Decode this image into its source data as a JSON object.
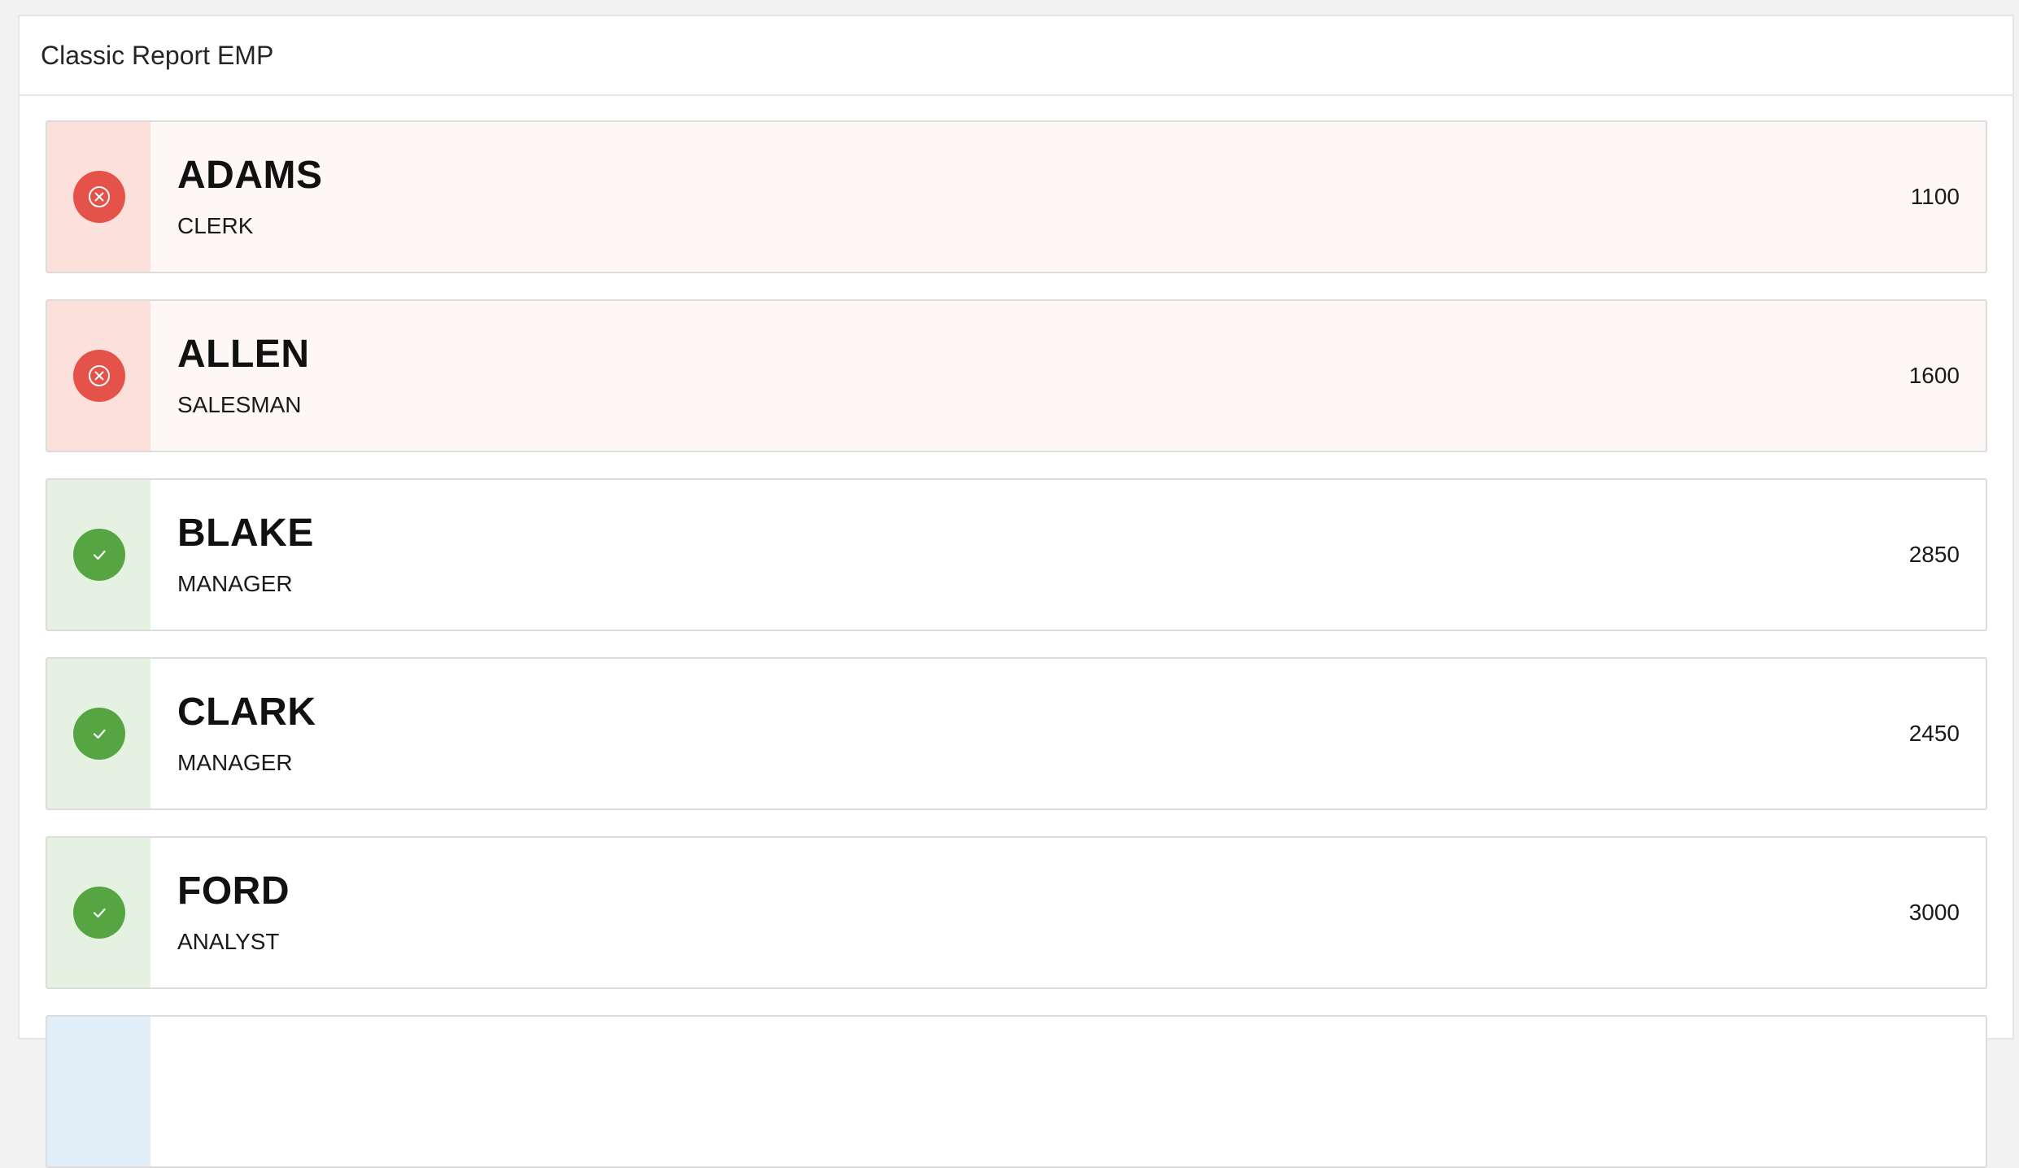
{
  "region": {
    "title": "Classic Report EMP"
  },
  "rows": [
    {
      "name": "ADAMS",
      "job": "CLERK",
      "value": "1100",
      "status": "danger",
      "icon": "close-circle-icon"
    },
    {
      "name": "ALLEN",
      "job": "SALESMAN",
      "value": "1600",
      "status": "danger",
      "icon": "close-circle-icon"
    },
    {
      "name": "BLAKE",
      "job": "MANAGER",
      "value": "2850",
      "status": "success",
      "icon": "check-icon"
    },
    {
      "name": "CLARK",
      "job": "MANAGER",
      "value": "2450",
      "status": "success",
      "icon": "check-icon"
    },
    {
      "name": "FORD",
      "job": "ANALYST",
      "value": "3000",
      "status": "success",
      "icon": "check-icon"
    },
    {
      "name": "",
      "job": "",
      "value": "",
      "status": "info",
      "icon": ""
    }
  ],
  "colors": {
    "danger_badge": "#e5524a",
    "danger_side": "#fbe0dc",
    "danger_card": "#fdf7f5",
    "success_badge": "#56a543",
    "success_side": "#e6f2e1",
    "info_side": "#e1eef7"
  }
}
